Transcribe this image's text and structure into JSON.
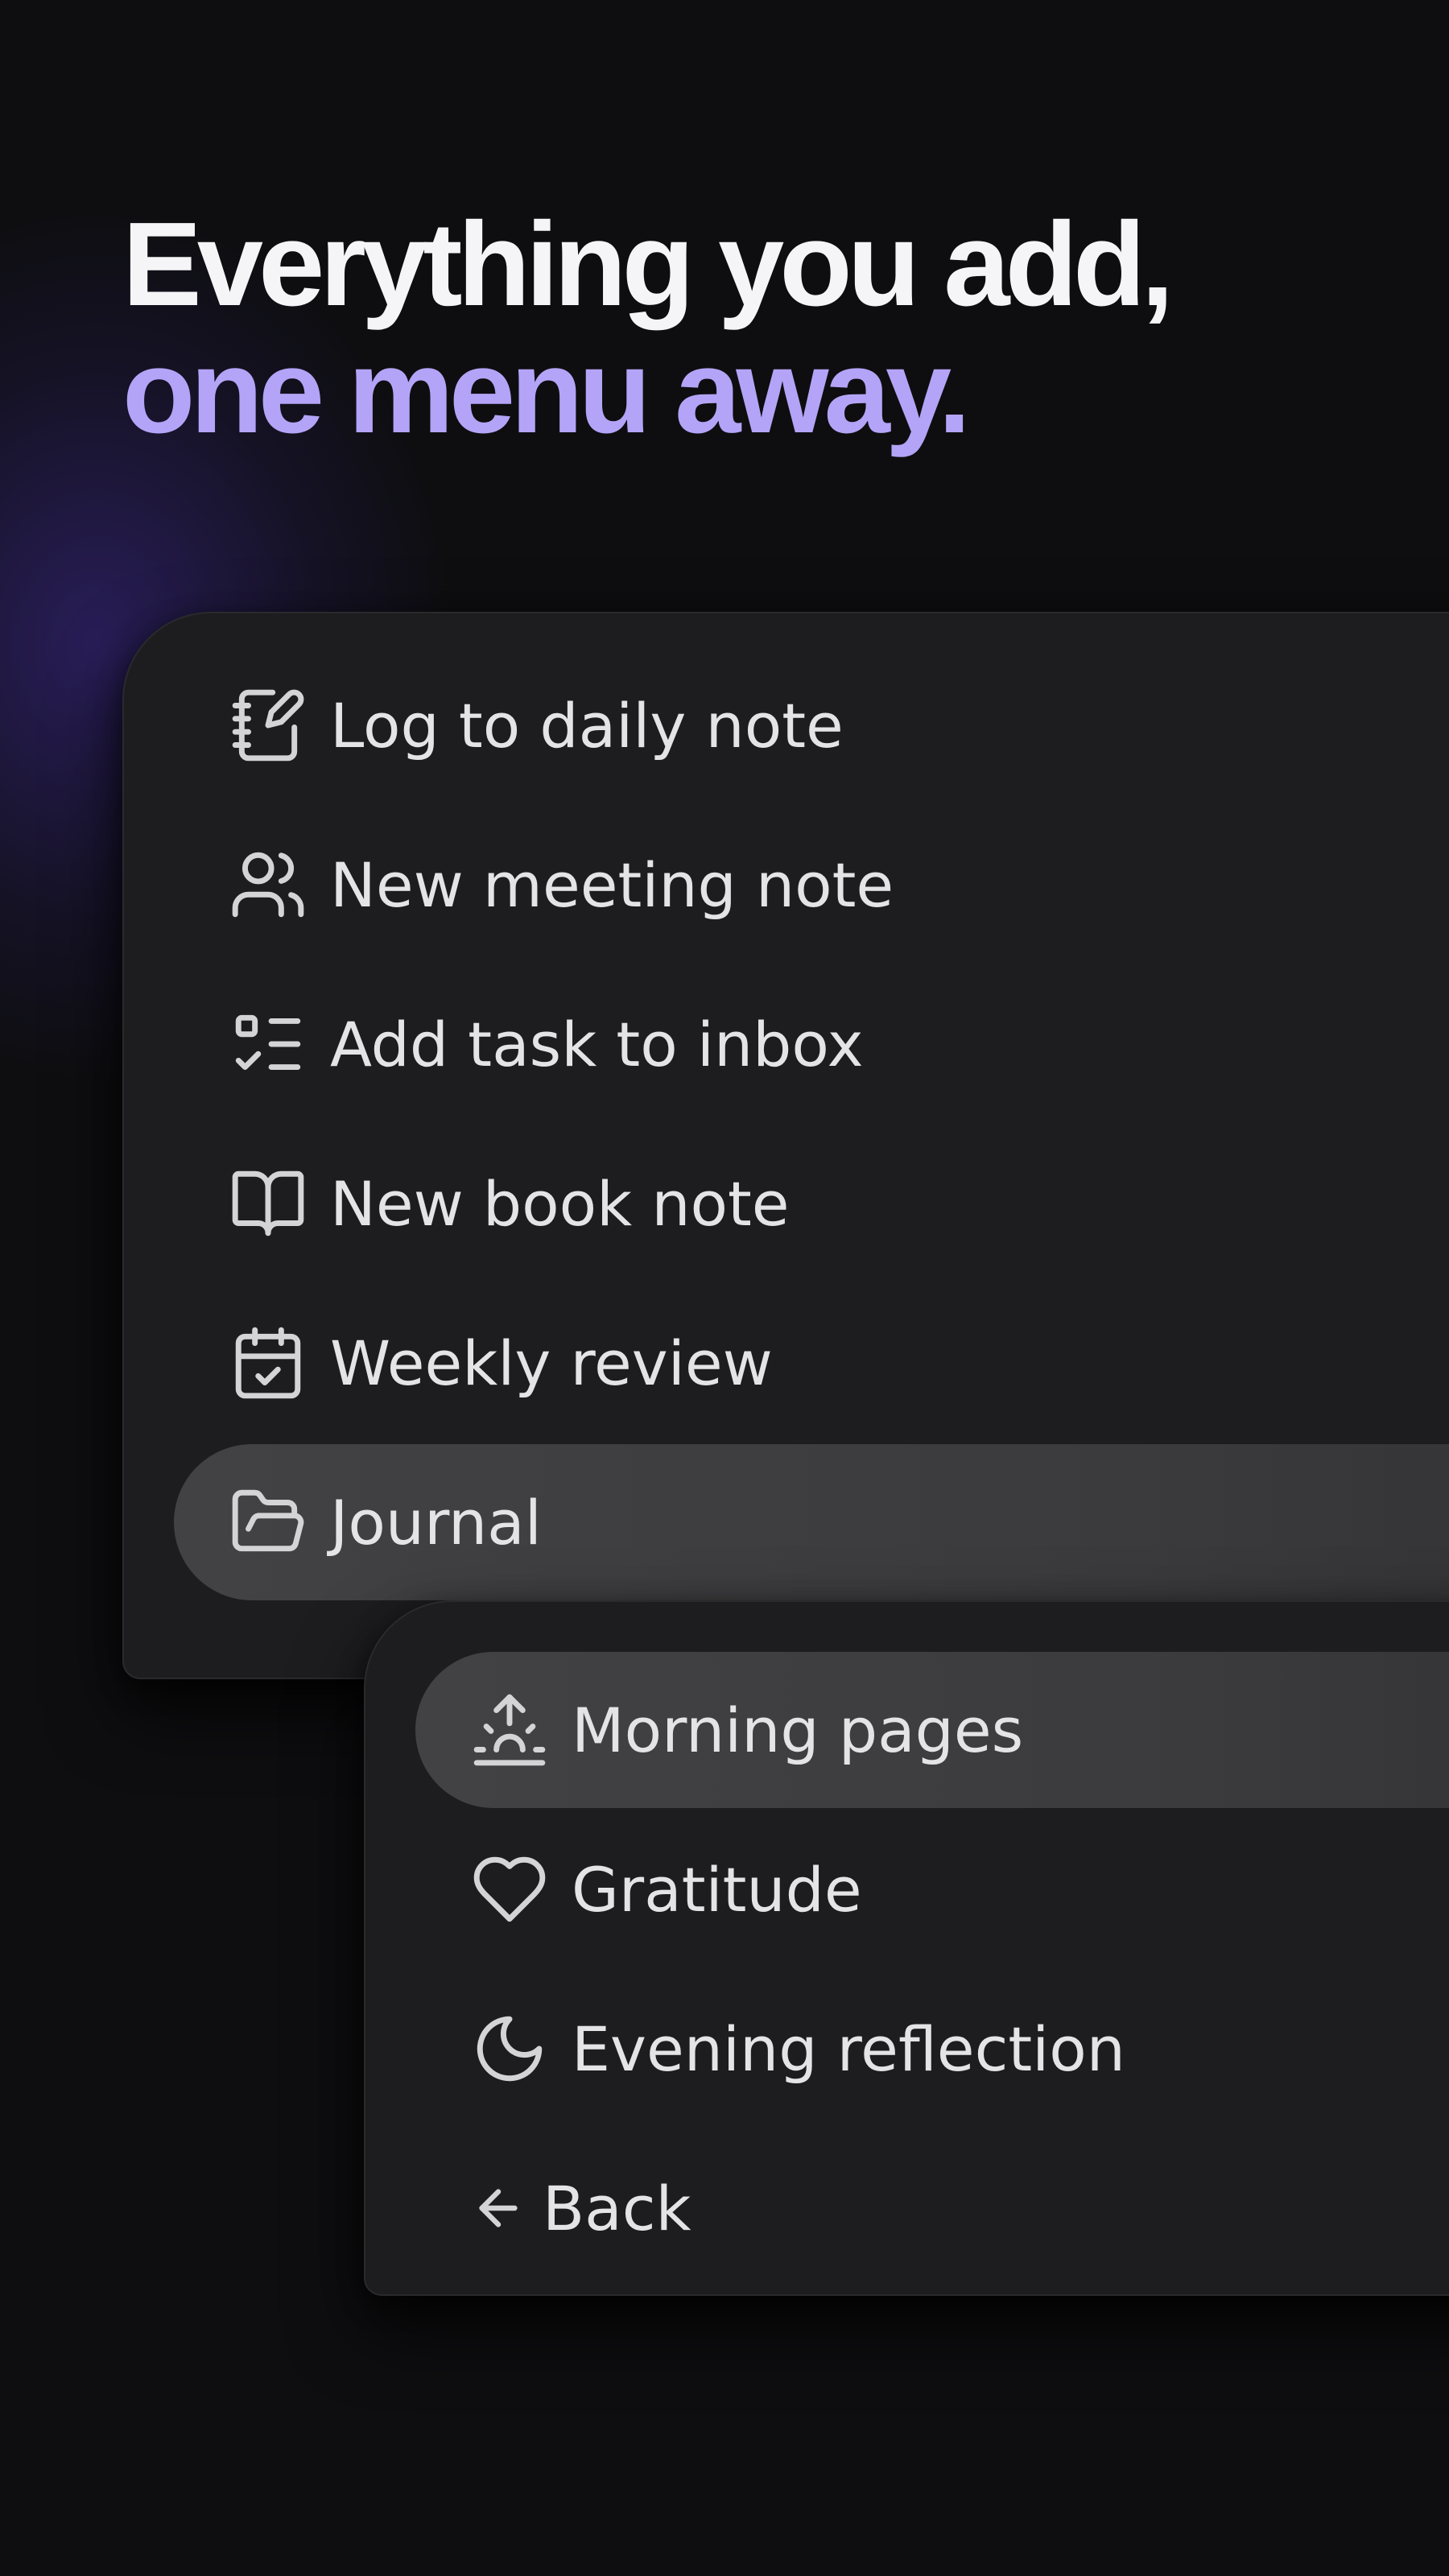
{
  "headline": {
    "line1": "Everything you add,",
    "line2": "one menu away."
  },
  "main_menu": {
    "items": [
      {
        "label": "Log to daily note",
        "icon": "notebook-pen-icon"
      },
      {
        "label": "New meeting note",
        "icon": "users-icon"
      },
      {
        "label": "Add task to inbox",
        "icon": "checklist-icon"
      },
      {
        "label": "New book note",
        "icon": "book-open-icon"
      },
      {
        "label": "Weekly review",
        "icon": "calendar-check-icon"
      },
      {
        "label": "Journal",
        "icon": "folder-open-icon",
        "highlighted": true
      }
    ]
  },
  "submenu": {
    "items": [
      {
        "label": "Morning pages",
        "icon": "sunrise-icon",
        "highlighted": true
      },
      {
        "label": "Gratitude",
        "icon": "heart-icon"
      },
      {
        "label": "Evening reflection",
        "icon": "moon-icon"
      }
    ],
    "back": {
      "label": "Back",
      "icon": "arrow-left-icon"
    }
  },
  "colors": {
    "background": "#0e0e10",
    "menu_surface": "#1d1d1f",
    "highlight": "#424244",
    "accent": "#b4a4f7",
    "text": "#e4e4e6"
  }
}
